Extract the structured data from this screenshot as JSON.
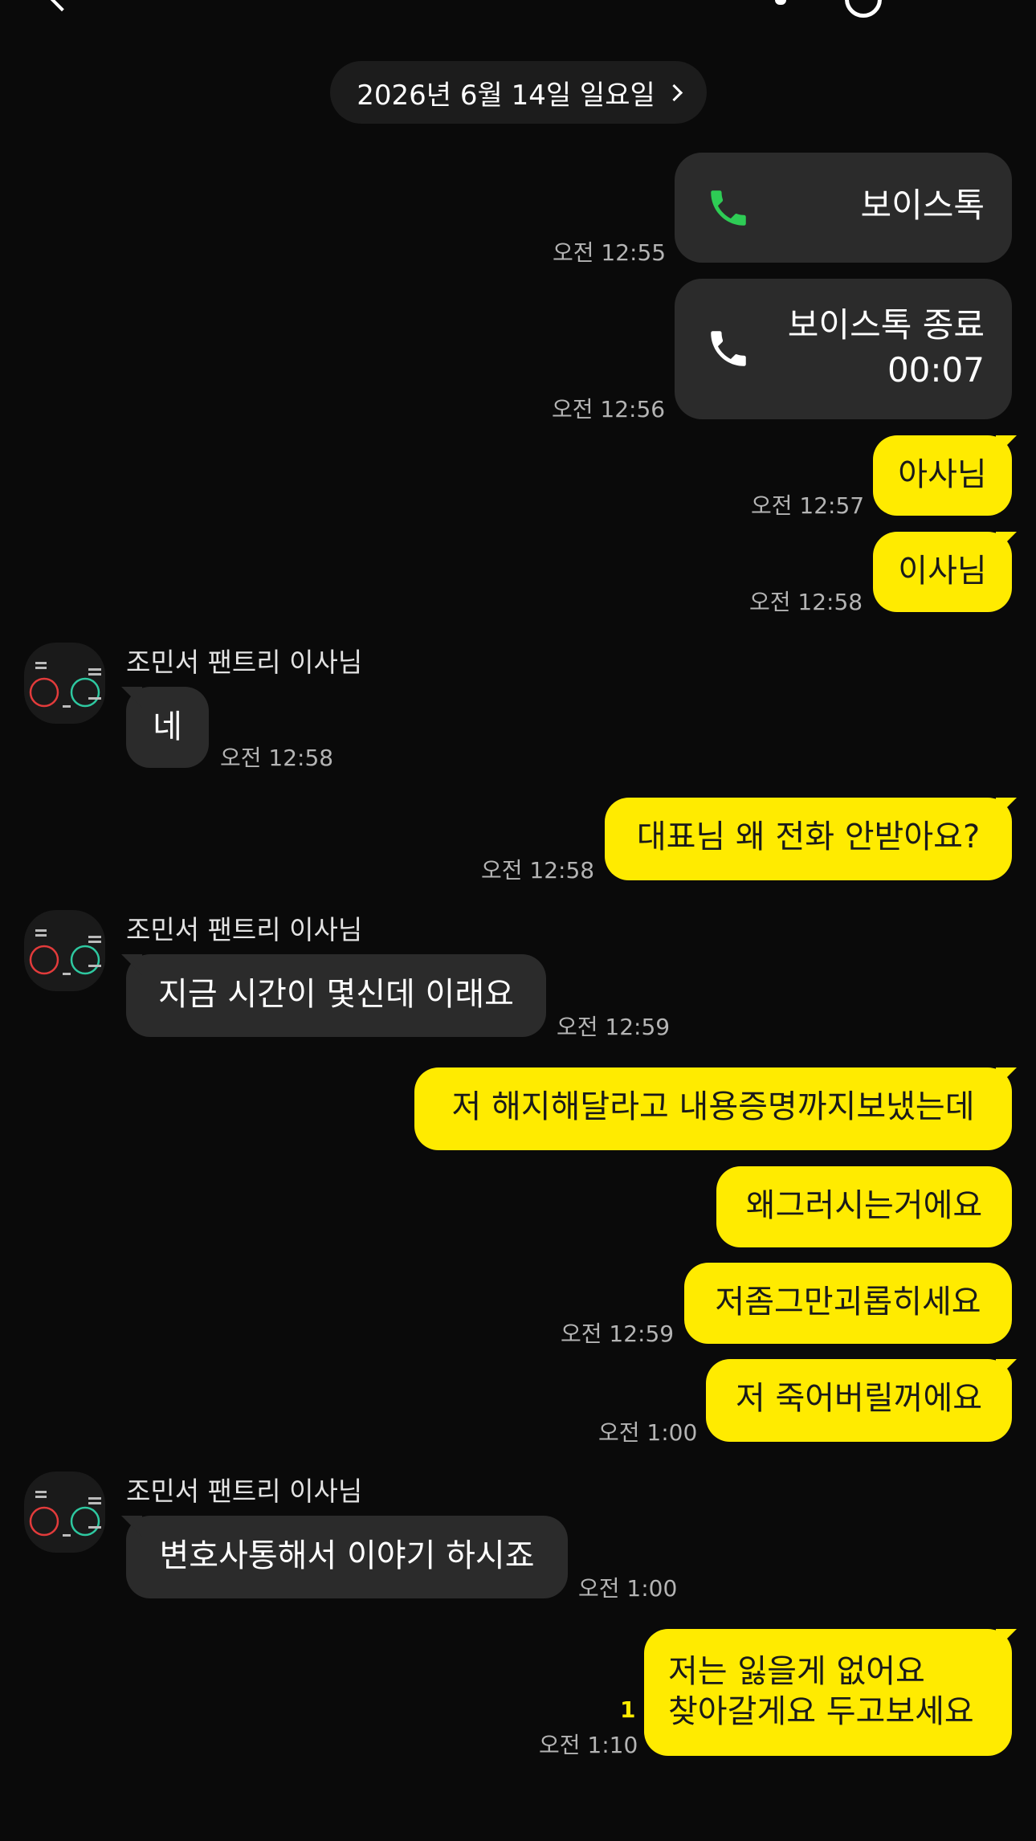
{
  "date_divider": "2026년 6월 14일 일요일",
  "messages": {
    "call_start": {
      "label": "보이스톡",
      "time": "오전 12:55"
    },
    "call_end": {
      "label": "보이스톡 종료",
      "duration": "00:07",
      "time": "오전 12:56"
    },
    "m1": {
      "text": "아사님",
      "time": "오전 12:57"
    },
    "m2": {
      "text": "이사님",
      "time": "오전 12:58"
    },
    "r1": {
      "sender": "조민서 팬트리 이사님",
      "text": "네",
      "time": "오전 12:58"
    },
    "m3": {
      "text": "대표님 왜 전화 안받아요?",
      "time": "오전 12:58"
    },
    "r2": {
      "sender": "조민서 팬트리 이사님",
      "text": "지금 시간이 몇신데 이래요",
      "time": "오전 12:59"
    },
    "m4": {
      "text": "저 해지해달라고 내용증명까지보냈는데"
    },
    "m5": {
      "text": "왜그러시는거에요"
    },
    "m6": {
      "text": "저좀그만괴롭히세요",
      "time": "오전 12:59"
    },
    "m7": {
      "text": "저 죽어버릴꺼에요",
      "time": "오전 1:00"
    },
    "r3": {
      "sender": "조민서 팬트리 이사님",
      "text": "변호사통해서 이야기 하시죠",
      "time": "오전 1:00"
    },
    "m8": {
      "line1": "저는 잃을게 없어요",
      "line2": "찾아갈게요 두고보세요",
      "unread": "1",
      "time": "오전 1:10"
    }
  },
  "colors": {
    "background": "#0a0a0a",
    "my_bubble": "#ffeb00",
    "their_bubble": "#2b2b2b",
    "call_icon_green": "#2ecc55",
    "unread": "#ffeb00"
  },
  "icons": {
    "call_start": "phone-icon-green",
    "call_end": "phone-icon-white",
    "date_more": "chevron-right-icon"
  }
}
